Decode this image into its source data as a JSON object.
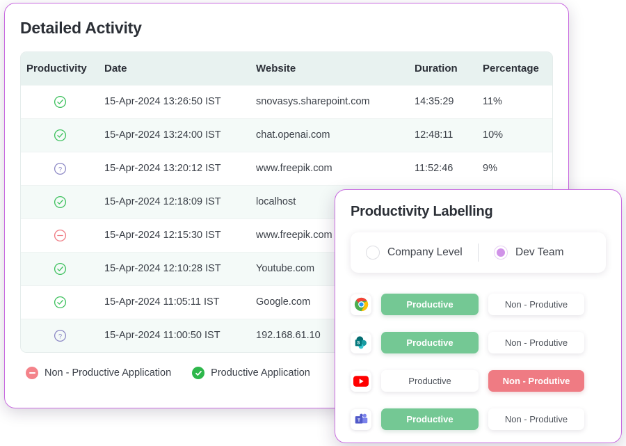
{
  "activity": {
    "title": "Detailed Activity",
    "columns": [
      "Productivity",
      "Date",
      "Website",
      "Duration",
      "Percentage"
    ],
    "rows": [
      {
        "status": "productive",
        "date": "15-Apr-2024 13:26:50 IST",
        "website": "snovasys.sharepoint.com",
        "duration": "14:35:29",
        "percentage": "11%"
      },
      {
        "status": "productive",
        "date": "15-Apr-2024 13:24:00 IST",
        "website": "chat.openai.com",
        "duration": "12:48:11",
        "percentage": "10%"
      },
      {
        "status": "unlabelled",
        "date": "15-Apr-2024 13:20:12 IST",
        "website": " www.freepik.com",
        "duration": "11:52:46",
        "percentage": "9%"
      },
      {
        "status": "productive",
        "date": "15-Apr-2024 12:18:09 IST",
        "website": "localhost",
        "duration": "",
        "percentage": ""
      },
      {
        "status": "nonproductive",
        "date": "15-Apr-2024 12:15:30 IST",
        "website": "www.freepik.com",
        "duration": "",
        "percentage": ""
      },
      {
        "status": "productive",
        "date": "15-Apr-2024 12:10:28 IST",
        "website": "Youtube.com",
        "duration": "",
        "percentage": ""
      },
      {
        "status": "productive",
        "date": "15-Apr-2024 11:05:11 IST",
        "website": "Google.com",
        "duration": "",
        "percentage": ""
      },
      {
        "status": "unlabelled",
        "date": "15-Apr-2024 11:00:50 IST",
        "website": "192.168.61.10",
        "duration": "",
        "percentage": ""
      }
    ],
    "legend": [
      {
        "icon": "minus-circle-icon",
        "label": "Non - Productive Application",
        "color": "#f4838a"
      },
      {
        "icon": "check-circle-icon",
        "label": "Productive Application",
        "color": "#2eb74b"
      }
    ]
  },
  "labelling": {
    "title": "Productivity Labelling",
    "scope": {
      "options": [
        {
          "label": "Company Level",
          "selected": false
        },
        {
          "label": "Dev Team",
          "selected": true
        }
      ],
      "selected_color": "#d092e8"
    },
    "productive_label": "Productive",
    "nonproductive_label": "Non - Produtive",
    "apps": [
      {
        "icon": "chrome-icon",
        "name": "Google Chrome",
        "selected": "productive"
      },
      {
        "icon": "sharepoint-icon",
        "name": "Microsoft SharePoint",
        "selected": "productive"
      },
      {
        "icon": "youtube-icon",
        "name": "YouTube",
        "selected": "nonproductive"
      },
      {
        "icon": "teams-icon",
        "name": "Microsoft Teams",
        "selected": "productive"
      }
    ]
  },
  "colors": {
    "accent_border": "#c86ae0",
    "productive_green": "#74c894",
    "nonproductive_red": "#ef7b83",
    "table_header_bg": "#e8f2f0"
  }
}
